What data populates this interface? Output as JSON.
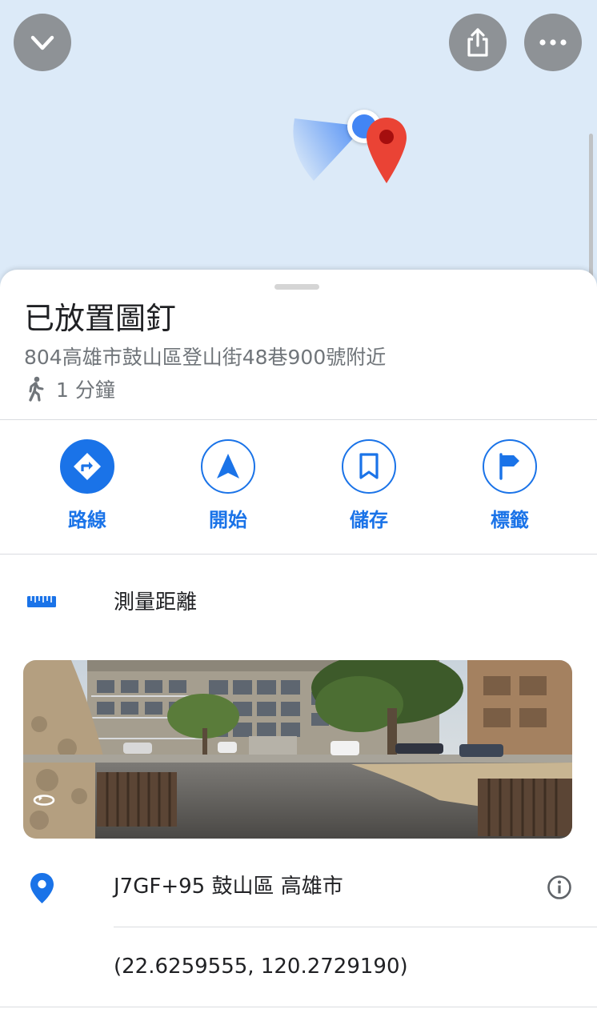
{
  "colors": {
    "accent": "#1a73e8",
    "pin_red": "#ea4335",
    "map_bg": "#dceaf8",
    "text_secondary": "#70757a"
  },
  "map": {
    "collapse_icon": "chevron-down-icon",
    "share_icon": "share-icon",
    "more_icon": "more-horiz-icon"
  },
  "place": {
    "title": "已放置圖釘",
    "address": "804高雄市鼓山區登山街48巷900號附近",
    "walk_time": "1 分鐘"
  },
  "actions": [
    {
      "label": "路線",
      "icon": "directions-icon"
    },
    {
      "label": "開始",
      "icon": "navigation-icon"
    },
    {
      "label": "儲存",
      "icon": "bookmark-icon"
    },
    {
      "label": "標籤",
      "icon": "flag-icon"
    }
  ],
  "measure": {
    "label": "測量距離",
    "icon": "ruler-icon"
  },
  "street_view": {
    "icon": "360-rotate-icon"
  },
  "info": {
    "plus_code": "J7GF+95 鼓山區 高雄市",
    "coordinates": "(22.6259555, 120.2729190)"
  }
}
